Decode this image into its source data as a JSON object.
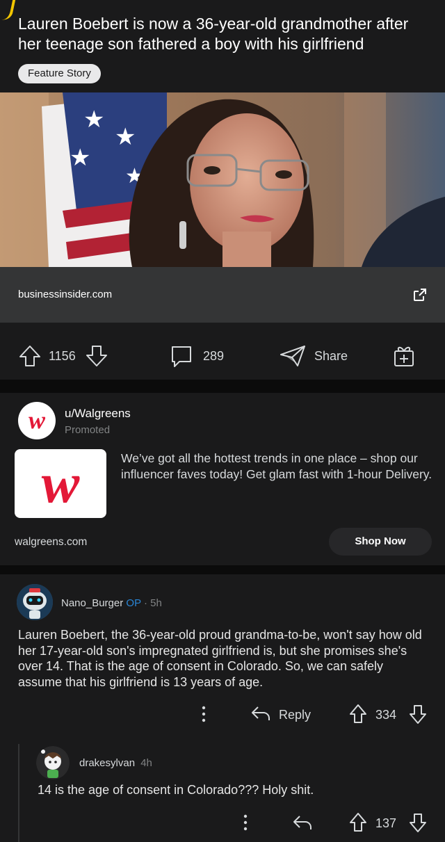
{
  "post": {
    "title": "Lauren Boebert is now a 36-year-old grandmother after her teenage son fathered a boy with his girlfriend",
    "flair": "Feature Story",
    "link_domain": "businessinsider.com",
    "upvotes": "1156",
    "comments": "289",
    "share_label": "Share"
  },
  "promo": {
    "username": "u/Walgreens",
    "label": "Promoted",
    "text": "We’ve got all the hottest trends in one place – shop our influencer faves today! Get glam fast with 1-hour Delivery.",
    "domain": "walgreens.com",
    "cta": "Shop Now",
    "brand_color": "#e31837"
  },
  "comment": {
    "username": "Nano_Burger",
    "op_badge": "OP",
    "time": "· 5h",
    "body": "Lauren Boebert, the 36-year-old proud grandma-to-be, won't say how old her 17-year-old son's impregnated girlfriend is, but she promises she's over 14.  That is the age of consent in Colorado. So, we can safely assume that his girlfriend is 13 years of age.",
    "reply_label": "Reply",
    "score": "334"
  },
  "reply": {
    "username": "drakesylvan",
    "time": "4h",
    "body": "14 is the age of consent in Colorado??? Holy shit.",
    "score": "137"
  },
  "colors": {
    "background": "#0b0b0b",
    "card": "#1a1a1b",
    "op": "#2a86d6"
  }
}
